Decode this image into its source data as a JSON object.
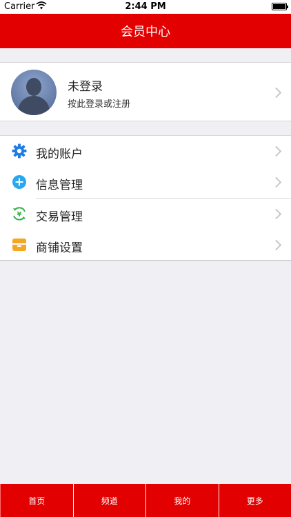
{
  "status_bar": {
    "carrier": "Carrier",
    "time": "2:44 PM"
  },
  "header": {
    "title": "会员中心"
  },
  "profile": {
    "name": "未登录",
    "subtitle": "按此登录或注册"
  },
  "menu": {
    "items": [
      {
        "label": "我的账户",
        "icon": "gear-icon",
        "color": "#1e7ce6"
      },
      {
        "label": "信息管理",
        "icon": "plus-circle-icon",
        "color": "#29a8f0"
      },
      {
        "label": "交易管理",
        "icon": "yen-refresh-icon",
        "color": "#35b34a"
      },
      {
        "label": "商铺设置",
        "icon": "shop-icon",
        "color": "#f5a623"
      }
    ]
  },
  "tabbar": {
    "items": [
      {
        "label": "首页"
      },
      {
        "label": "频道"
      },
      {
        "label": "我的"
      },
      {
        "label": "更多"
      }
    ]
  },
  "colors": {
    "brand_red": "#e30000",
    "background": "#efeff4"
  }
}
